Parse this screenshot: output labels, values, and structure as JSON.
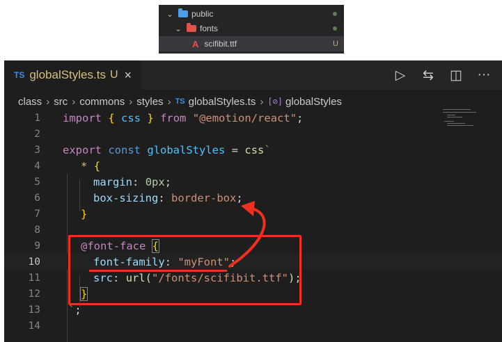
{
  "explorer": {
    "items": [
      {
        "label": "public",
        "icon": "folder-icon",
        "status": "dot"
      },
      {
        "label": "fonts",
        "icon": "folder-icon",
        "status": "dot"
      },
      {
        "label": "scifibit.ttf",
        "icon": "font-file-icon",
        "status": "U"
      }
    ]
  },
  "tab": {
    "badge": "TS",
    "title": "globalStyles.ts",
    "status": "U",
    "close": "×"
  },
  "actions": {
    "run": "▷",
    "compare": "⇆",
    "split": "◫",
    "more": "···"
  },
  "breadcrumb": {
    "items": [
      "class",
      "src",
      "commons",
      "styles",
      "globalStyles.ts",
      "globalStyles"
    ],
    "ts_badge": "TS",
    "symbol_icon": "[⊘]",
    "sep": "›"
  },
  "code": {
    "line_numbers": [
      "1",
      "2",
      "3",
      "4",
      "5",
      "6",
      "7",
      "8",
      "9",
      "10",
      "11",
      "12",
      "13",
      "14"
    ],
    "current_line": "10",
    "l1": {
      "kw": "import",
      "o": "{",
      "name": "css",
      "c": "}",
      "from": "from",
      "str": "\"@emotion/react\"",
      "semi": ";"
    },
    "l3": {
      "kw1": "export",
      "kw2": "const",
      "name": "globalStyles",
      "eq": "=",
      "fn": "css",
      "tick": "`"
    },
    "l4": {
      "sel": "*",
      "o": "{"
    },
    "l5": {
      "prop": "margin",
      "colon": ":",
      "val": "0px",
      "semi": ";"
    },
    "l6": {
      "prop": "box-sizing",
      "colon": ":",
      "val": "border-box",
      "semi": ";"
    },
    "l7": {
      "c": "}"
    },
    "l9": {
      "at": "@font-face",
      "o": "{"
    },
    "l10": {
      "prop": "font-family",
      "colon": ":",
      "val": "\"myFont\"",
      "semi": ";"
    },
    "l11": {
      "prop": "src",
      "colon": ":",
      "fn": "url(",
      "val": "\"/fonts/scifibit.ttf\"",
      "close": ")",
      "semi": ";"
    },
    "l12": {
      "c": "}"
    },
    "l13": {
      "tick": "`",
      "semi": ";"
    }
  },
  "colors": {
    "annotation": "#f0301c",
    "editor_bg": "#1e1e1e",
    "tab_modified": "#d7c07a"
  }
}
